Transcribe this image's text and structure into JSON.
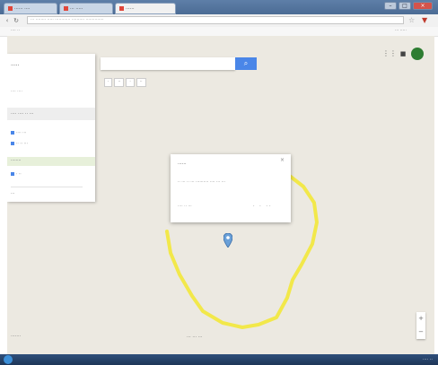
{
  "browser": {
    "tabs": [
      {
        "label": "······ ····"
      },
      {
        "label": "··· ·····"
      },
      {
        "label": "······"
      }
    ],
    "address": "··· ········ ····· ············ ·········· ··············",
    "bookmark_left": "···· ··",
    "bookmark_right": "··· ·····"
  },
  "map": {
    "zoom_pills": [
      "·",
      "··",
      "·",
      "··"
    ],
    "zoom_in": "+",
    "zoom_out": "−",
    "bottom_left_label": "·······",
    "bottom_center_label": "··· ··· ···"
  },
  "side_panel": {
    "title": "·····",
    "subtitle": "···· ····",
    "header": "···· ···· ·· ···",
    "items": [
      "···· ···",
      "·· ·· ···"
    ],
    "selected_item": "········",
    "extra_item": "· ··",
    "footer_item": "···"
  },
  "info_window": {
    "title": "······",
    "text": "·· ··· ·· ··· ·········· ···· ··· ···",
    "link": "···· ·· ···",
    "actions": "· · ··"
  },
  "taskbar": {
    "tray": "···· ··"
  },
  "colors": {
    "drawn_shape": "#f2e84a",
    "map_background": "#ece9e1",
    "search_button": "#4a86e8",
    "avatar": "#2e7d32"
  },
  "icons": {
    "search": "search-icon",
    "apps": "apps-grid-icon",
    "notifications": "bell-icon",
    "pin": "map-pin-icon",
    "close": "close-icon",
    "star": "star-icon",
    "menu": "menu-icon"
  }
}
